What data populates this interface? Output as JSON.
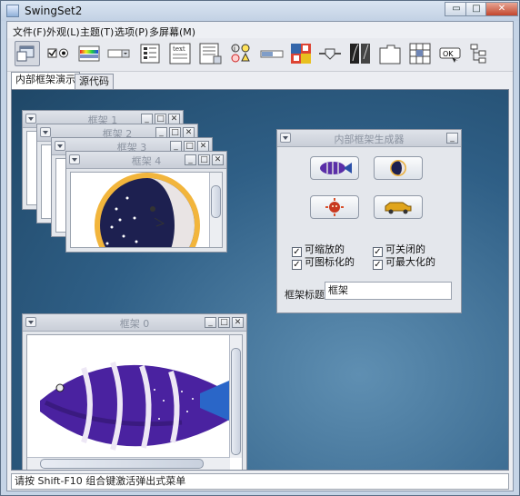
{
  "window": {
    "title": "SwingSet2",
    "controls": [
      "▭",
      "□",
      "✕"
    ]
  },
  "menubar": [
    "文件(F)",
    "外观(L)",
    "主题(T)",
    "选项(P)",
    "多屏幕(M)"
  ],
  "toolbar": {
    "icons": [
      "internal-frame-icon",
      "checkbox-radio-icon",
      "color-chooser-icon",
      "combobox-icon",
      "file-chooser-icon",
      "editor-pane-icon",
      "html-icon",
      "list-icon",
      "option-pane-icon",
      "progress-bar-icon",
      "scroll-pane-icon",
      "slider-icon",
      "split-pane-icon",
      "tabbed-pane-icon",
      "table-icon",
      "tooltip-icon",
      "tree-icon"
    ]
  },
  "tabs": [
    "内部框架演示",
    "源代码"
  ],
  "frames": {
    "f1": "框架 1",
    "f2": "框架 2",
    "f3": "框架 3",
    "f4": "框架 4",
    "f0": "框架 0"
  },
  "generator": {
    "title": "内部框架生成器",
    "checkboxes": [
      {
        "label": "可缩放的",
        "checked": true
      },
      {
        "label": "可关闭的",
        "checked": true
      },
      {
        "label": "可图标化的",
        "checked": true
      },
      {
        "label": "可最大化的",
        "checked": true
      }
    ],
    "frame_title_label": "框架标题:",
    "frame_title_value": "框架"
  },
  "status": "请按 Shift-F10 组合键激活弹出式菜单"
}
